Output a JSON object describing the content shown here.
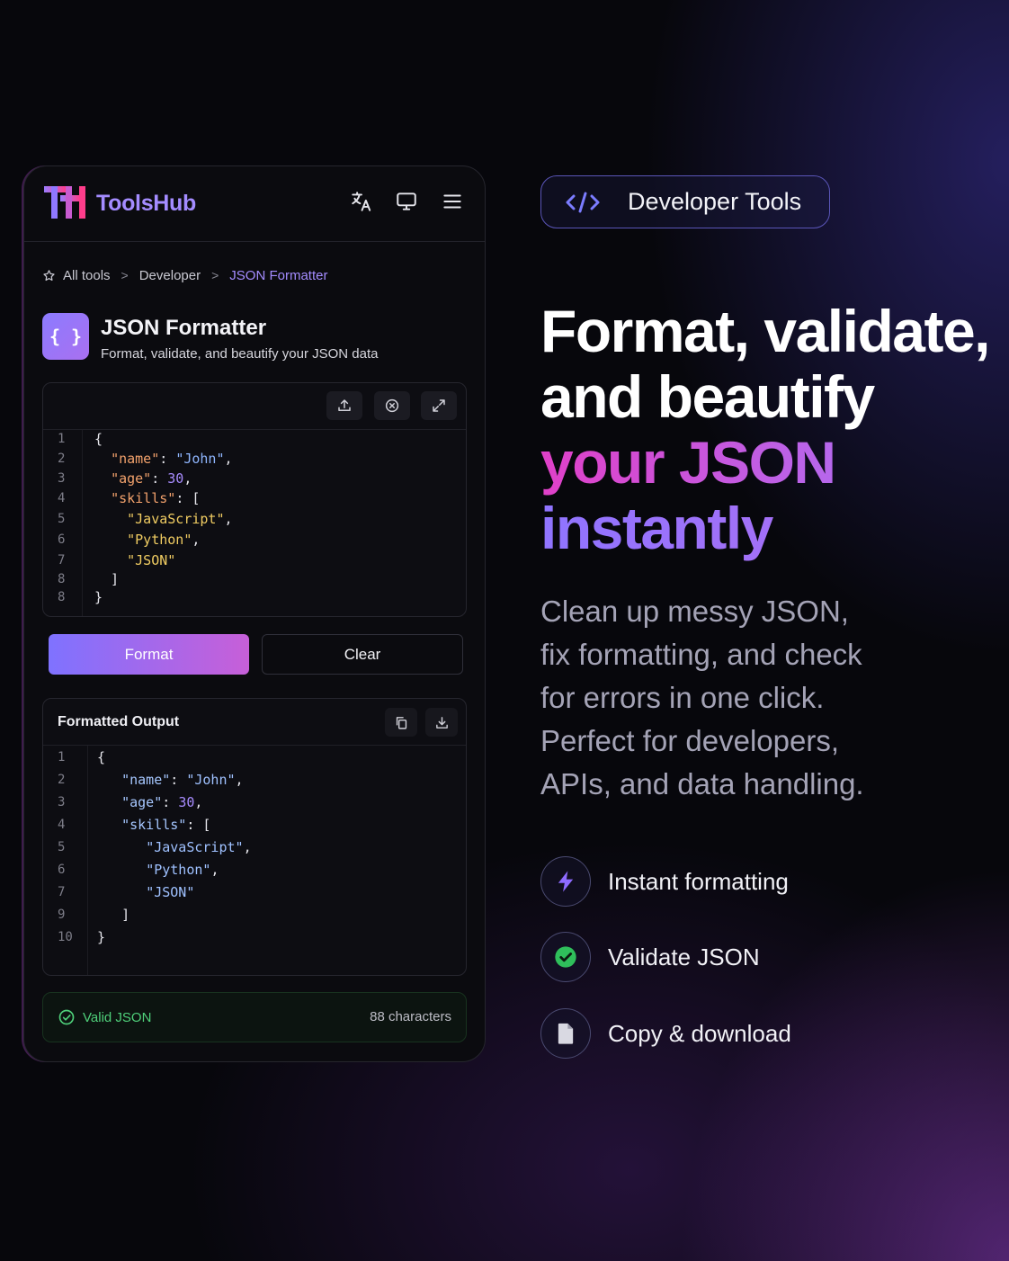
{
  "app": {
    "brand_mark": "TH",
    "brand_name": "ToolsHub",
    "colors": {
      "accent": "#a48cff",
      "brand_pink": "#ff3d8b",
      "success": "#4fd07a"
    },
    "topbar_icons": [
      "translate-icon",
      "monitor-icon",
      "menu-icon"
    ]
  },
  "breadcrumb": {
    "items": [
      "All tools",
      "Developer",
      "JSON Formatter"
    ],
    "separator": ">"
  },
  "tool": {
    "icon_glyph": "{ }",
    "title": "JSON Formatter",
    "subtitle": "Format, validate, and beautify your JSON data"
  },
  "input_editor": {
    "toolbar_icons": [
      "upload-icon",
      "clear-circle-icon",
      "expand-icon"
    ],
    "line_numbers": [
      "1",
      "2",
      "3",
      "4",
      "5",
      "6",
      "7",
      "8",
      "8"
    ],
    "lines": [
      "{",
      "  \"name\": \"John\",",
      "  \"age\": 30,",
      "  \"skills\": [",
      "    \"JavaScript\",",
      "    \"Python\",",
      "    \"JSON\"",
      "  ]",
      "}"
    ]
  },
  "actions": {
    "format_label": "Format",
    "clear_label": "Clear"
  },
  "output": {
    "title": "Formatted Output",
    "toolbar_icons": [
      "copy-icon",
      "download-icon"
    ],
    "line_numbers": [
      "1",
      "2",
      "3",
      "4",
      "5",
      "6",
      "7",
      "9",
      "10"
    ],
    "lines": [
      "{",
      "   \"name\": \"John\",",
      "   \"age\": 30,",
      "   \"skills\": [",
      "      \"JavaScript\",",
      "      \"Python\",",
      "      \"JSON\"",
      "   ]",
      "}"
    ]
  },
  "status": {
    "valid_label": "Valid JSON",
    "char_count": "88 characters"
  },
  "promo": {
    "pill_label": "Developer Tools",
    "headline": [
      "Format, validate,",
      "and beautify",
      "your JSON",
      "instantly"
    ],
    "description": [
      "Clean up messy JSON,",
      "fix formatting, and check",
      "for errors in one click.",
      "Perfect for developers,",
      "APIs, and data handling."
    ],
    "features": [
      {
        "icon": "lightning-icon",
        "label": "Instant formatting"
      },
      {
        "icon": "check-circle-icon",
        "label": "Validate JSON"
      },
      {
        "icon": "file-icon",
        "label": "Copy & download"
      }
    ]
  }
}
